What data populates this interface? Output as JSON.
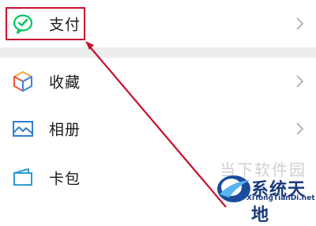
{
  "menu": {
    "items": [
      {
        "label": "支付",
        "icon": "wechat-pay-icon",
        "icon_color": "#07c160"
      },
      {
        "label": "收藏",
        "icon": "favorites-cube-icon"
      },
      {
        "label": "相册",
        "icon": "album-picture-icon",
        "icon_color": "#2f7fd6"
      },
      {
        "label": "卡包",
        "icon": "card-wallet-icon",
        "icon_color": "#2f9bd8"
      }
    ]
  },
  "annotation": {
    "highlight_color": "#c8102e",
    "target": "支付"
  },
  "watermark": {
    "partial_text": "当下软件园",
    "brand": "系统天地",
    "url": "XiTongTianDi.net"
  }
}
